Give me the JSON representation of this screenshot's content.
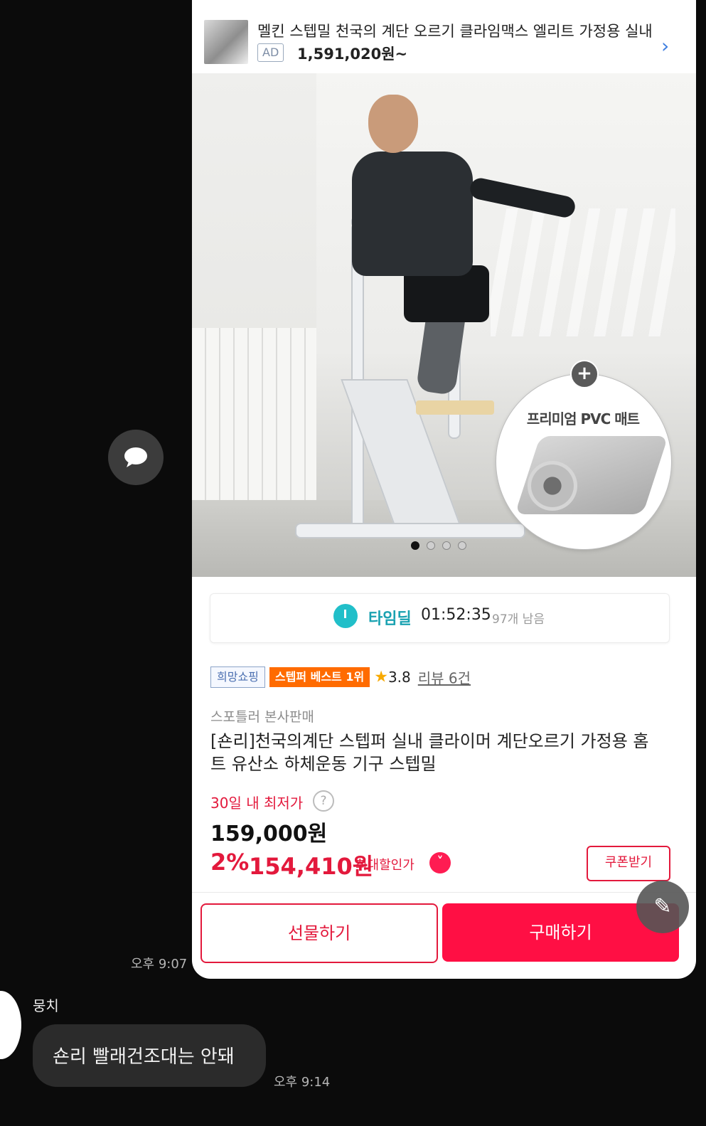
{
  "ad": {
    "title": "멜킨 스텝밀 천국의 계단 오르기 클라임맥스 엘리트 가정용 실내 홈",
    "badge": "AD",
    "price": "1,591,020원~"
  },
  "hero": {
    "promo_title": "프리미엄 PVC 매트",
    "carousel_total": 4,
    "carousel_active": 1
  },
  "timedeal": {
    "label": "타임딜",
    "time": "01:52:35",
    "remaining": "97개 남음"
  },
  "badges": {
    "hope": "희망쇼핑",
    "best": "스텝퍼 베스트 1위",
    "rating": "3.8",
    "review": "리뷰 6건"
  },
  "product": {
    "seller": "스포틀러 본사판매",
    "title": "[숀리]천국의계단 스텝퍼 실내 클라이머 계단오르기 가정용 홈트 유산소 하체운동 기구 스텝밀",
    "lowest_label": "30일 내 최저가",
    "original_price": "159,000원",
    "discount_rate": "2%",
    "discount_price": "154,410원",
    "max_label": "최대할인가",
    "coupon": "쿠폰받기"
  },
  "actions": {
    "gift": "선물하기",
    "buy": "구매하기"
  },
  "chat": {
    "time_1": "오후 9:07",
    "sender": "뭉치",
    "message": "숀리 빨래건조대는 안돼",
    "time_2": "오후 9:14"
  },
  "colors": {
    "accent_red": "#ff0f44",
    "timedeal_teal": "#1aa2b1",
    "best_orange": "#ff6b00"
  }
}
